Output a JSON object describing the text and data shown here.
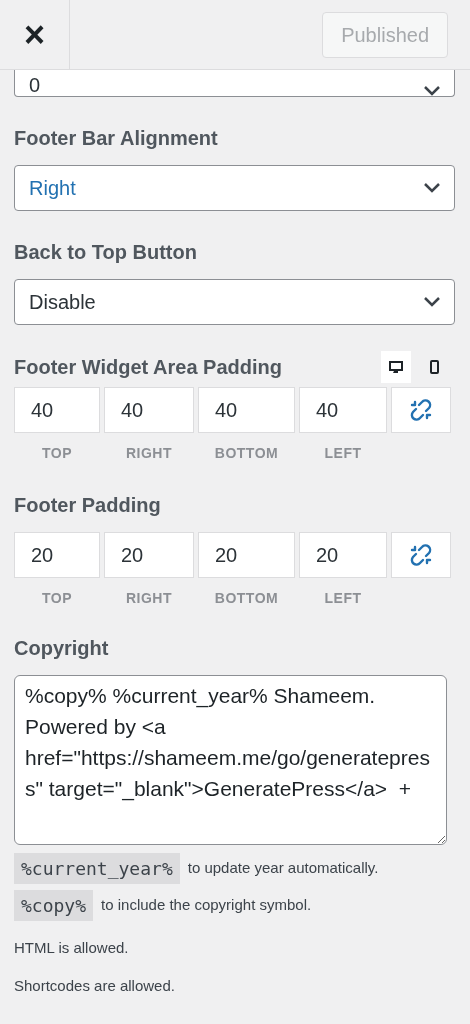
{
  "header": {
    "close": "×",
    "publish_button": {
      "label": "Published",
      "disabled": true
    }
  },
  "fields": [
    {
      "kind": "select",
      "value": "0",
      "highlighted": false
    },
    {
      "kind": "select",
      "label": "Footer Bar Alignment",
      "value": "Right",
      "highlighted": true
    },
    {
      "kind": "select",
      "label": "Back to Top Button",
      "value": "Disable",
      "highlighted": false
    },
    {
      "kind": "spacing",
      "label": "Footer Widget Area Padding",
      "devices": [
        {
          "kind": "desktop",
          "selected": true
        },
        {
          "kind": "mobile",
          "selected": false
        }
      ],
      "values": [
        {
          "value": "40",
          "caption": "TOP"
        },
        {
          "value": "40",
          "caption": "RIGHT"
        },
        {
          "value": "40",
          "caption": "BOTTOM"
        },
        {
          "value": "40",
          "caption": "LEFT"
        }
      ]
    },
    {
      "kind": "spacing",
      "label": "Footer Padding",
      "values": [
        {
          "value": "20",
          "caption": "TOP"
        },
        {
          "value": "20",
          "caption": "RIGHT"
        },
        {
          "value": "20",
          "caption": "BOTTOM"
        },
        {
          "value": "20",
          "caption": "LEFT"
        }
      ]
    },
    {
      "kind": "textarea",
      "label": "Copyright",
      "value": "%copy% %current_year% Shameem. Powered by <a href=\"https://shameem.me/go/generatepress\" target=\"_blank\">GeneratePress</a>  +",
      "hints": [
        {
          "code": "%current_year%",
          "text": "to update year automatically."
        },
        {
          "code": "%copy%",
          "text": "to include the copyright symbol."
        }
      ],
      "notes": [
        "HTML is allowed.",
        "Shortcodes are allowed."
      ]
    }
  ]
}
